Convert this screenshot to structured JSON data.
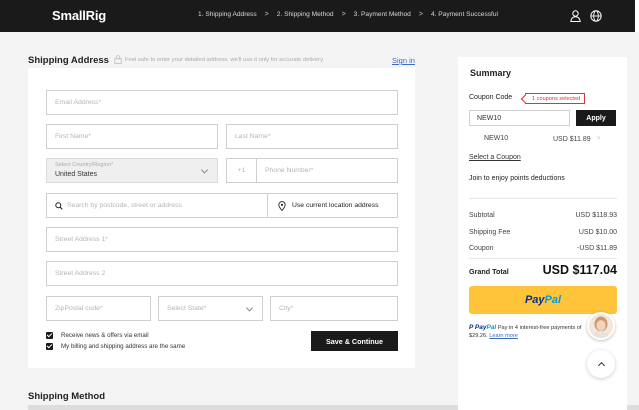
{
  "header": {
    "logo": "SmallRig",
    "steps": [
      "1. Shipping Address",
      "2. Shipping Method",
      "3. Payment Method",
      "4. Payment Successful"
    ],
    "icons": [
      "user-icon",
      "globe-icon"
    ]
  },
  "shipping_address": {
    "title": "Shipping Address",
    "safe_note": "Feel safe to enter your detailed address, we'll use it only for accurate delivery.",
    "sign_in": "Sign in",
    "email_placeholder": "Email Address*",
    "first_name_placeholder": "First Name*",
    "last_name_placeholder": "Last Name*",
    "country_label": "Select Country/Region*",
    "country_value": "United States",
    "phone_code": "+1",
    "phone_placeholder": "Phone Number*",
    "search_placeholder": "Search by postcode, street or address",
    "use_location": "Use current location address",
    "street1_placeholder": "Street Address 1*",
    "street2_placeholder": "Street Address 2",
    "zip_placeholder": "ZipPostal code*",
    "state_placeholder": "Select State*",
    "city_placeholder": "City*",
    "check_news": "Receive news & offers via email",
    "check_billing": "My billing and shipping address are the same",
    "save_button": "Save & Continue"
  },
  "shipping_method": {
    "title": "Shipping Method"
  },
  "summary": {
    "title": "Summary",
    "coupon_code_label": "Coupon Code",
    "coupon_badge": "1 coupons selected",
    "coupon_input_value": "NEW10",
    "apply_button": "Apply",
    "applied_coupon": {
      "code": "NEW10",
      "value": "USD $11.89",
      "remove": "×"
    },
    "select_coupon": "Select a Coupon",
    "points": "Join to enjoy points deductions",
    "rows": [
      {
        "label": "Subtotal",
        "value": "USD $118.93"
      },
      {
        "label": "Shipping Fee",
        "value": "USD $10.00"
      },
      {
        "label": "Coupon",
        "value": "-USD $11.89"
      }
    ],
    "grand_total_label": "Grand Total",
    "grand_total_value": "USD $117.04",
    "paypal_1": "Pay",
    "paypal_2": "Pal",
    "paylater_pre": "Pay in 4 interest-free payments of $29.26.",
    "paylater_link": "Learn more"
  },
  "colors": {
    "accent": "#1a1a1a",
    "paypal_yellow": "#ffc439",
    "link": "#3a6cc7",
    "alert": "#d33"
  }
}
